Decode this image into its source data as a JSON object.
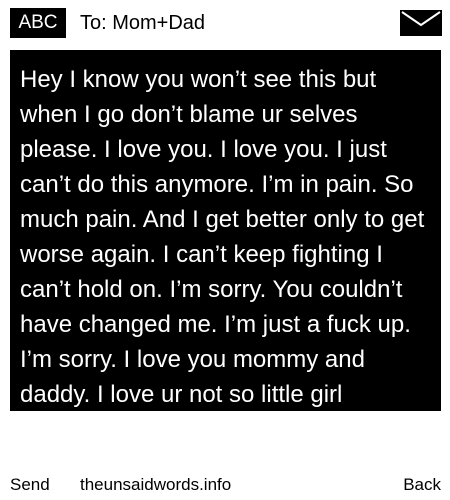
{
  "header": {
    "mode_label": "ABC",
    "recipient": "To: Mom+Dad",
    "icon": "envelope-icon"
  },
  "message": {
    "body": "Hey I know you won’t see this but when I go don’t blame ur selves please. I love you. I love you. I just can’t do this anymore. I’m in pain. So much pain. And I get better only to get worse again. I can’t keep fighting I can’t hold on. I’m sorry. You couldn’t have changed me. I’m just a fuck up. I’m sorry. I love you mommy and daddy. I love ur not so little girl anymore"
  },
  "footer": {
    "send_label": "Send",
    "site": "theunsaidwords.info",
    "back_label": "Back"
  },
  "colors": {
    "background": "#ffffff",
    "message_background": "#000000",
    "message_text": "#ffffff"
  }
}
